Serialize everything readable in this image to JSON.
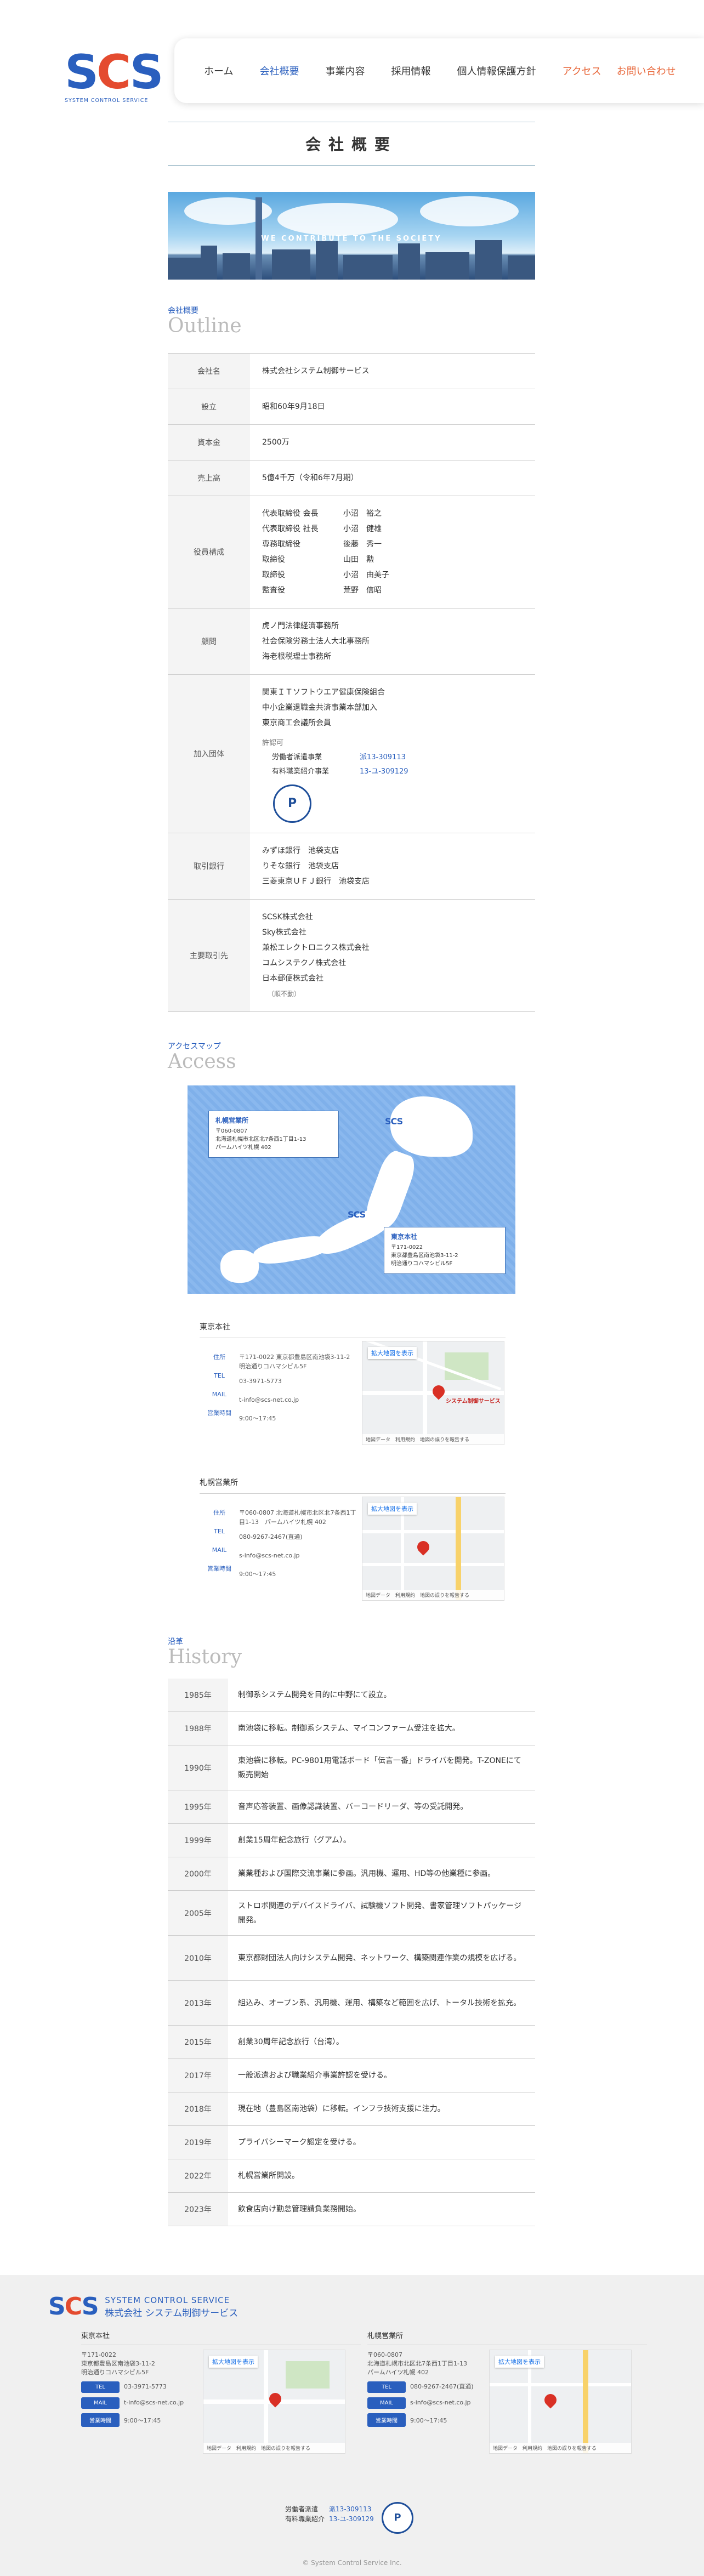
{
  "logo": {
    "mark_a": "S",
    "mark_b": "C",
    "mark_c": "S",
    "sub": "SYSTEM CONTROL SERVICE"
  },
  "nav": {
    "items": [
      {
        "label": "ホーム"
      },
      {
        "label": "会社概要"
      },
      {
        "label": "事業内容"
      },
      {
        "label": "採用情報"
      },
      {
        "label": "個人情報保護方針"
      },
      {
        "label": "アクセス"
      },
      {
        "label": "お問い合わせ"
      }
    ]
  },
  "page_title": "会社概要",
  "hero_caption": "WE CONTRIBUTE TO THE SOCIETY",
  "outline": {
    "heading_jp": "会社概要",
    "heading_en": "Outline",
    "company_label": "会社名",
    "company": "株式会社システム制御サービス",
    "founded_label": "設立",
    "founded": "昭和60年9月18日",
    "capital_label": "資本金",
    "capital": "2500万",
    "sales_label": "売上高",
    "sales": "5億4千万（令和6年7月期）",
    "officers_label": "役員構成",
    "officers": [
      {
        "pos": "代表取締役 会長",
        "name": "小沼　裕之"
      },
      {
        "pos": "代表取締役 社長",
        "name": "小沼　健雄"
      },
      {
        "pos": "専務取締役",
        "name": "後藤　秀一"
      },
      {
        "pos": "取締役",
        "name": "山田　勲"
      },
      {
        "pos": "取締役",
        "name": "小沼　由美子"
      },
      {
        "pos": "監査役",
        "name": "荒野　信昭"
      }
    ],
    "advisors_label": "顧問",
    "advisors": [
      "虎ノ門法律経済事務所",
      "社会保険労務士法人大北事務所",
      "海老根税理士事務所"
    ],
    "membership_label": "加入団体",
    "memberships": [
      "関東ＩＴソフトウエア健康保険組合",
      "中小企業退職金共済事業本部加入",
      "東京商工会議所会員"
    ],
    "permit_title": "許認可",
    "permits": [
      {
        "name": "労働者派遣事業",
        "no": "派13-309113"
      },
      {
        "name": "有料職業紹介事業",
        "no": "13-ユ-309129"
      }
    ],
    "pmark_label": "P",
    "banks_label": "取引銀行",
    "banks": [
      "みずほ銀行　池袋支店",
      "りそな銀行　池袋支店",
      "三菱東京ＵＦＪ銀行　池袋支店"
    ],
    "clients_label": "主要取引先",
    "clients": [
      "SCSK株式会社",
      "Sky株式会社",
      "兼松エレクトロニクス株式会社",
      "コムシステクノ株式会社",
      "日本郵便株式会社"
    ],
    "clients_note": "（順不動）"
  },
  "access": {
    "heading_jp": "アクセスマップ",
    "heading_en": "Access",
    "map_sapporo": {
      "title": "札幌営業所",
      "zip": "〒060-0807",
      "addr": "北海道札幌市北区北7条西1丁目1-13",
      "bldg": "パームハイツ札幌 402"
    },
    "map_tokyo": {
      "title": "東京本社",
      "zip": "〒171-0022",
      "addr": "東京都豊島区南池袋3-11-2",
      "bldg": "明治通りコハマシビル5F"
    },
    "mini_logo": "SCS",
    "tokyo": {
      "title": "東京本社",
      "addr_label": "住所",
      "addr": "〒171-0022 東京都豊島区南池袋3-11-2　明治通りコハマシビル5F",
      "tel_label": "TEL",
      "tel": "03-3971-5773",
      "mail_label": "MAIL",
      "mail": "t-info@scs-net.co.jp",
      "hours_label": "営業時間",
      "hours": "9:00〜17:45"
    },
    "sapporo": {
      "title": "札幌営業所",
      "addr_label": "住所",
      "addr": "〒060-0807 北海道札幌市北区北7条西1丁目1-13　パームハイツ札幌 402",
      "tel_label": "TEL",
      "tel": "080-9267-2467(直通)",
      "mail_label": "MAIL",
      "mail": "s-info@scs-net.co.jp",
      "hours_label": "営業時間",
      "hours": "9:00〜17:45"
    },
    "gmap": {
      "enlarge": "拡大地図を表示",
      "footer": "地図データ　利用規約　地図の誤りを報告する",
      "pin_label": "システム制御サービス"
    }
  },
  "history": {
    "heading_jp": "沿革",
    "heading_en": "History",
    "events": [
      {
        "year": "1985年",
        "text": "制御系システム開発を目的に中野にて設立。"
      },
      {
        "year": "1988年",
        "text": "南池袋に移転。制御系システム、マイコンファーム受注を拡大。"
      },
      {
        "year": "1990年",
        "text": "東池袋に移転。PC-9801用電話ボード「伝言一番」ドライバを開発。T-ZONEにて販売開始"
      },
      {
        "year": "1995年",
        "text": "音声応答装置、画像認識装置、バーコードリーダ、等の受託開発。"
      },
      {
        "year": "1999年",
        "text": "創業15周年記念旅行（グアム）。"
      },
      {
        "year": "2000年",
        "text": "業業種および国際交流事業に参画。汎用機、運用、HD等の他業種に参画。"
      },
      {
        "year": "2005年",
        "text": "ストロボ関連のデバイスドライバ、試験機ソフト開発、書家管理ソフトパッケージ開発。"
      },
      {
        "year": "2010年",
        "text": "東京都財団法人向けシステム開発、ネットワーク、構築関連作業の規模を広げる。"
      },
      {
        "year": "2013年",
        "text": "組込み、オープン系、汎用機、運用、構築など範囲を広げ、トータル技術を拡充。"
      },
      {
        "year": "2015年",
        "text": "創業30周年記念旅行（台湾）。"
      },
      {
        "year": "2017年",
        "text": "一般派遣および職業紹介事業許認を受ける。"
      },
      {
        "year": "2018年",
        "text": "現在地（豊島区南池袋）に移転。インフラ技術支援に注力。"
      },
      {
        "year": "2019年",
        "text": "プライバシーマーク認定を受ける。"
      },
      {
        "year": "2022年",
        "text": "札幌営業所開設。"
      },
      {
        "year": "2023年",
        "text": "飲食店向け勤怠管理請負業務開始。"
      }
    ]
  },
  "footer": {
    "logo_a": "SYSTEM CONTROL SERVICE",
    "logo_b": "株式会社 システム制御サービス",
    "tokyo": {
      "title": "東京本社",
      "zip": "〒171-0022",
      "addr": "東京都豊島区南池袋3-11-2",
      "bldg": "明治通りコハマシビル5F",
      "tel_label": "TEL",
      "tel": "03-3971-5773",
      "mail_label": "MAIL",
      "mail": "t-info@scs-net.co.jp",
      "hours_label": "営業時間",
      "hours": "9:00〜17:45"
    },
    "sapporo": {
      "title": "札幌営業所",
      "zip": "〒060-0807",
      "addr": "北海道札幌市北区北7条西1丁目1-13",
      "bldg": "パームハイツ札幌 402",
      "tel_label": "TEL",
      "tel": "080-9267-2467(直通)",
      "mail_label": "MAIL",
      "mail": "s-info@scs-net.co.jp",
      "hours_label": "営業時間",
      "hours": "9:00〜17:45"
    },
    "permit1_label": "労働者派遣",
    "permit1": "派13-309113",
    "permit2_label": "有料職業紹介",
    "permit2": "13-ユ-309129",
    "copyright": "© System Control Service Inc."
  }
}
